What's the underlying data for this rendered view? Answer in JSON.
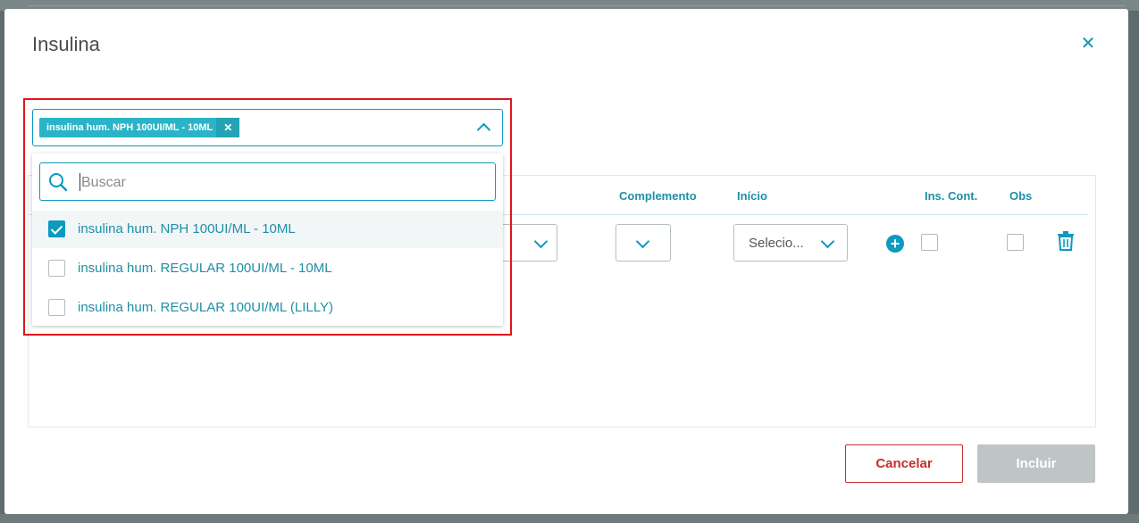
{
  "modal": {
    "title": "Insulina"
  },
  "multiselect": {
    "chip_label": "insulina hum. NPH 100UI/ML - 10ML"
  },
  "dropdown": {
    "search_placeholder": "Buscar",
    "options": [
      {
        "label": "insulina hum. NPH 100UI/ML - 10ML",
        "checked": true
      },
      {
        "label": "insulina hum. REGULAR 100UI/ML - 10ML",
        "checked": false
      },
      {
        "label": "insulina hum. REGULAR 100UI/ML (LILLY)",
        "checked": false
      }
    ]
  },
  "table": {
    "headers": {
      "complemento": "Complemento",
      "inicio": "Início",
      "ins_cont": "Ins. Cont.",
      "obs": "Obs"
    },
    "inicio_value": "Selecio..."
  },
  "footer": {
    "cancel_label": "Cancelar",
    "include_label": "Incluir"
  },
  "colors": {
    "accent": "#0c9abe",
    "danger": "#c4302b",
    "highlight_frame": "#e0151b",
    "disabled": "#bfc4c5"
  },
  "icons": [
    "close-icon",
    "chevron-up-icon",
    "search-icon",
    "chevron-down-icon",
    "plus-circle-icon",
    "trash-icon",
    "check-icon"
  ]
}
